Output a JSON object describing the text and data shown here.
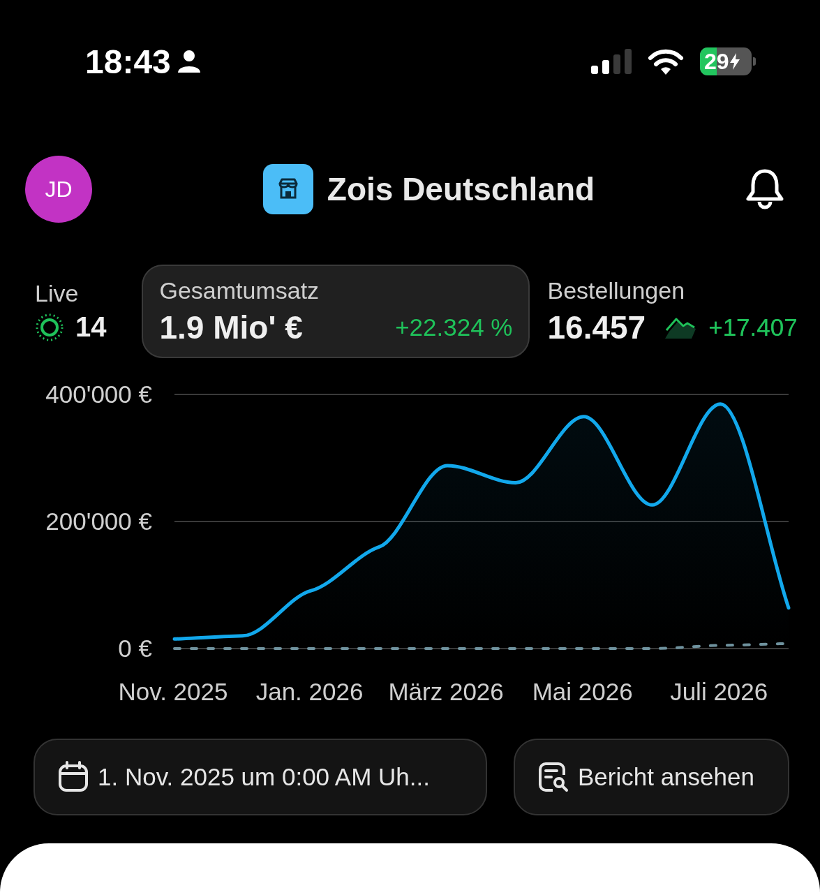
{
  "status_bar": {
    "time": "18:43",
    "battery": "29"
  },
  "header": {
    "avatar": "JD",
    "title": "Zois Deutschland"
  },
  "metrics": [
    {
      "kind": "live",
      "label": "Live",
      "value": "14",
      "selected": false
    },
    {
      "kind": "metric",
      "label": "Gesamtumsatz",
      "value": "1.9 Mio' €",
      "change": "+22.324 %",
      "selected": true
    },
    {
      "kind": "trend_metric",
      "label": "Bestellungen",
      "value": "16.457",
      "change": "+17.407",
      "selected": false
    }
  ],
  "chart": {
    "chart_data": {
      "type": "line",
      "categories": [
        "Nov. 2025",
        null,
        "Jan. 2026",
        null,
        "März 2026",
        null,
        "Mai 2026",
        null,
        "Juli 2026",
        null
      ],
      "yticks": [
        {
          "value": 0,
          "label": "0 €"
        },
        {
          "value": 200000,
          "label": "200'000 €"
        },
        {
          "value": 400000,
          "label": "400'000 €"
        }
      ],
      "ylim": [
        0,
        400000
      ],
      "series": [
        {
          "color": "#12a8ec",
          "type": "area",
          "line_style": "solid",
          "values": [
            15000,
            20000,
            91000,
            160000,
            288000,
            261000,
            365000,
            226000,
            385000,
            64000
          ]
        },
        {
          "color": "#6f929e",
          "type": "line",
          "line_style": "dashed",
          "values": [
            0,
            0,
            0,
            0,
            0,
            0,
            0,
            0,
            5000,
            8000
          ]
        }
      ]
    }
  },
  "actions": [
    {
      "kind": "date",
      "label": "1. Nov. 2025 um 0:00 AM Uh..."
    },
    {
      "kind": "report",
      "label": "Bericht ansehen"
    }
  ]
}
